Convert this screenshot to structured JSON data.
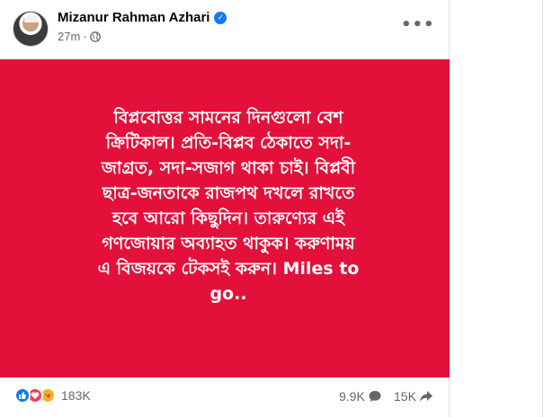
{
  "post": {
    "author": "Mizanur Rahman Azhari",
    "time": "27m",
    "separator": "·",
    "more": "•••",
    "body_lines": [
      "বিপ্লবোত্তর সামনের দিনগুলো বেশ",
      "ক্রিটিকাল। প্রতি-বিপ্লব ঠেকাতে সদা-",
      "জাগ্রত, সদা-সজাগ থাকা চাই। বিপ্লবী",
      "ছাত্র-জনতাকে রাজপথ দখলে রাখতে",
      "হবে আরো কিছুদিন। তারুণ্যের এই",
      "গণজোয়ার অব্যাহত থাকুক। করুণাময়",
      "এ বিজয়কে টেকসই করুন। Miles to",
      "go.."
    ],
    "background_color": "#e3103a"
  },
  "footer": {
    "reaction_count": "183K",
    "comment_count": "9.9K",
    "share_count": "15K",
    "reactions": [
      "like-icon",
      "love-icon",
      "care-icon"
    ]
  },
  "colors": {
    "verified": "#1877f2",
    "text_secondary": "#65676b"
  }
}
